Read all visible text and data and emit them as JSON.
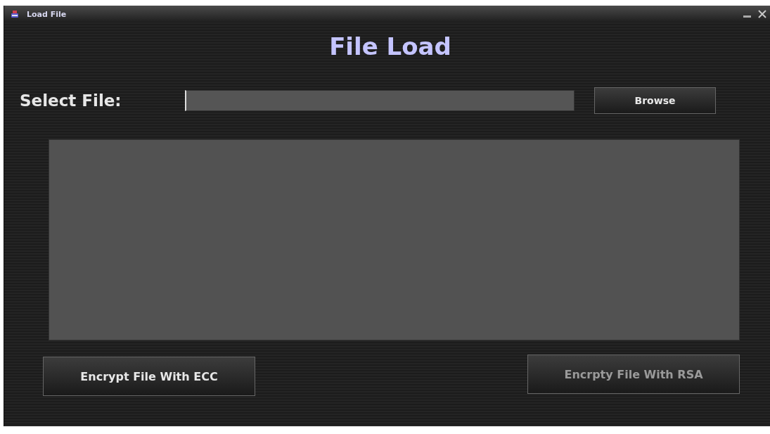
{
  "window": {
    "title": "Load File"
  },
  "heading": "File Load",
  "file_select": {
    "label": "Select File:",
    "button": "Browse"
  },
  "buttons": [
    {
      "label": "Encrypt File With ECC",
      "disabled": false
    },
    {
      "label": "Encrpty File With RSA",
      "disabled": true
    }
  ]
}
